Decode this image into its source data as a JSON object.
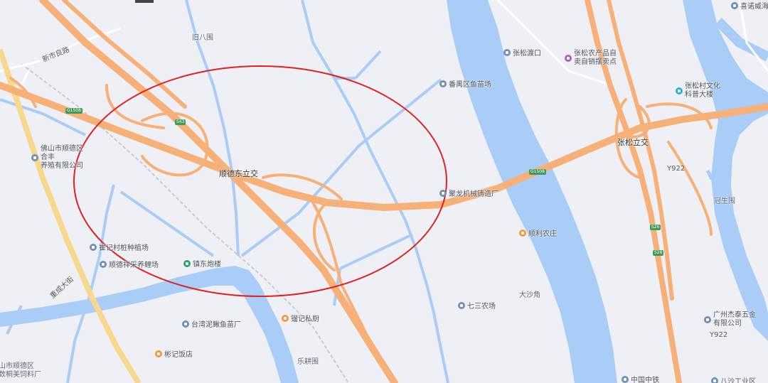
{
  "map": {
    "colors": {
      "background": "#eef0f5",
      "water": "#a9cdf7",
      "expressway": "#f7b077",
      "highlight_circle": "#e02020",
      "rail": "#c9c9cf"
    },
    "pois": [
      {
        "id": "jinbawei",
        "label": "旧八围",
        "icon": "none"
      },
      {
        "id": "panyu-fish",
        "label": "番禺区鱼苗场",
        "icon": "building-pin"
      },
      {
        "id": "zhangsong-ferry",
        "label": "张松渡口",
        "icon": "ferry-pin"
      },
      {
        "id": "zhangsong-farm",
        "label": "张松农产品自\n卖自销摆卖点",
        "icon": "shop-pin"
      },
      {
        "id": "zhangsong-culture",
        "label": "张松村文化\n科普大楼",
        "icon": "culture-pin"
      },
      {
        "id": "xilin-weihai",
        "label": "喜诺威海",
        "icon": "building-pin"
      },
      {
        "id": "foshan-coop",
        "label": "佛山市顺德区合丰\n养殖有限公司",
        "icon": "building-pin"
      },
      {
        "id": "shunde-east",
        "label": "顺德东立交",
        "icon": "none"
      },
      {
        "id": "julong",
        "label": "聚龙机械铸造厂",
        "icon": "building-pin"
      },
      {
        "id": "shunli",
        "label": "顺利农庄",
        "icon": "food-pin"
      },
      {
        "id": "zhangsong-interchange",
        "label": "张松立交",
        "icon": "none"
      },
      {
        "id": "guanshengwei",
        "label": "冠生围",
        "icon": "none"
      },
      {
        "id": "cui-plant",
        "label": "崔记村桩种植场",
        "icon": "building-pin"
      },
      {
        "id": "shunde-fish",
        "label": "顺德祥采养鲤场",
        "icon": "building-pin"
      },
      {
        "id": "zhendong",
        "label": "镇东炮楼",
        "icon": "scenic-pin"
      },
      {
        "id": "qisan",
        "label": "七三农场",
        "icon": "building-pin"
      },
      {
        "id": "dashajiao",
        "label": "大沙角",
        "icon": "none"
      },
      {
        "id": "taiwan-fish",
        "label": "台湾泥鳅鱼苗厂",
        "icon": "building-pin"
      },
      {
        "id": "ji-private",
        "label": "镏记私厨",
        "icon": "food-pin"
      },
      {
        "id": "bin-restaurant",
        "label": "彬记饭店",
        "icon": "food-pin"
      },
      {
        "id": "guangzhou-hardware",
        "label": "广州杰泰五金\n有限公司",
        "icon": "building-pin"
      },
      {
        "id": "lejiawei",
        "label": "乐耕围",
        "icon": "none"
      },
      {
        "id": "china-railway",
        "label": "中国中铁",
        "icon": "building-pin"
      },
      {
        "id": "shunde-feed",
        "label": "山市顺德区\n数桐美饲料厂",
        "icon": "none"
      },
      {
        "id": "basha",
        "label": "八沙工业区",
        "icon": "building-pin"
      }
    ],
    "roads": {
      "xinshi": "新市良路",
      "chongcheng": "重成大街",
      "g1508_a": "G1508",
      "g1508_b": "G1508",
      "s43": "S43",
      "y922_a": "Y922",
      "y922_b": "Y922",
      "s26_a": "S26",
      "s26_b": "S26"
    }
  }
}
